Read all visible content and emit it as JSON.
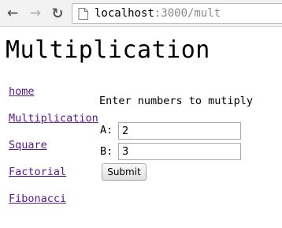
{
  "browser": {
    "url_host": "localhost",
    "url_rest": ":3000/mult"
  },
  "page": {
    "title": "Multiplication"
  },
  "nav": [
    {
      "label": "home"
    },
    {
      "label": "Multiplication"
    },
    {
      "label": "Square"
    },
    {
      "label": "Factorial"
    },
    {
      "label": "Fibonacci"
    }
  ],
  "form": {
    "prompt": "Enter numbers to mutiply",
    "a_label": "A:",
    "a_value": "2",
    "b_label": "B:",
    "b_value": "3",
    "submit_label": "Submit"
  }
}
